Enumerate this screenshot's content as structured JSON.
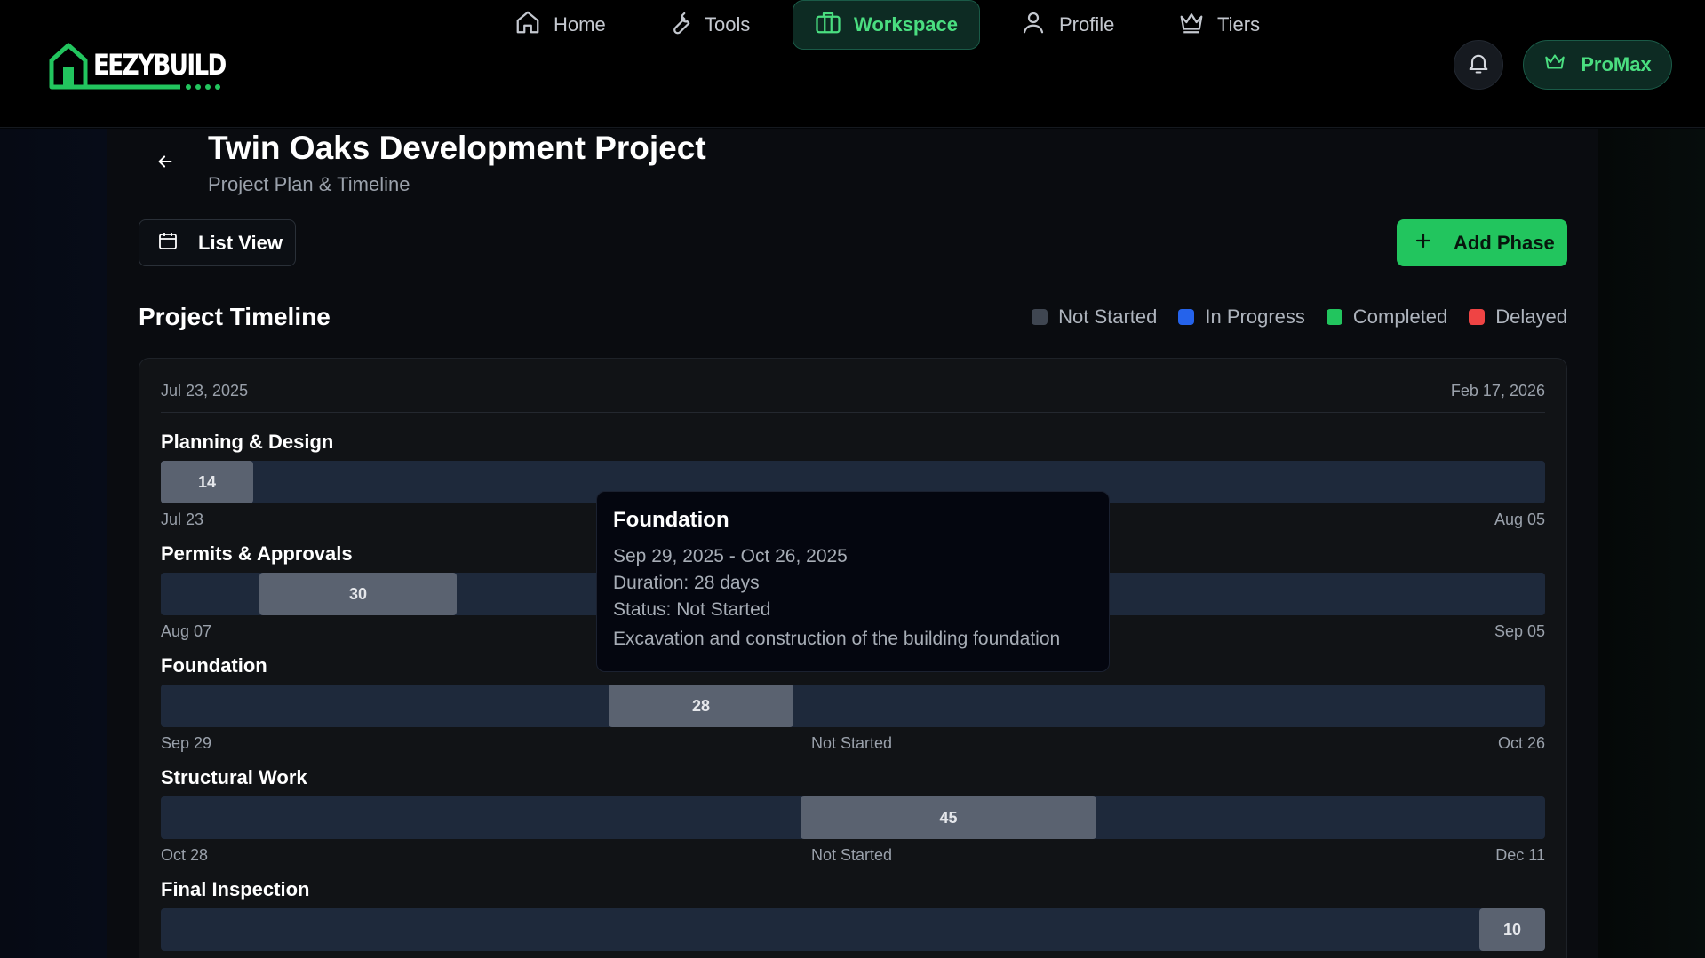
{
  "header": {
    "logo_text": "EEZYBUILD",
    "nav": [
      {
        "label": "Home",
        "icon": "home-icon"
      },
      {
        "label": "Tools",
        "icon": "wrench-icon"
      },
      {
        "label": "Workspace",
        "icon": "briefcase-icon"
      },
      {
        "label": "Profile",
        "icon": "user-icon"
      },
      {
        "label": "Tiers",
        "icon": "crown-icon"
      }
    ],
    "active_nav": "Workspace",
    "plan_label": "ProMax"
  },
  "page": {
    "title": "Twin Oaks Development Project",
    "subtitle": "Project Plan & Timeline",
    "list_view_label": "List View",
    "add_phase_label": "Add Phase"
  },
  "timeline": {
    "section_title": "Project Timeline",
    "legend": [
      {
        "label": "Not Started",
        "color": "#3f4651"
      },
      {
        "label": "In Progress",
        "color": "#2563eb"
      },
      {
        "label": "Completed",
        "color": "#22c55e"
      },
      {
        "label": "Delayed",
        "color": "#ef4444"
      }
    ],
    "range_start": "Jul 23, 2025",
    "range_end": "Feb 17, 2026",
    "phases": [
      {
        "name": "Planning & Design",
        "duration": "14",
        "start_label": "Jul 23",
        "end_label": "Aug 05",
        "status_label": ""
      },
      {
        "name": "Permits & Approvals",
        "duration": "30",
        "start_label": "Aug 07",
        "end_label": "Sep 05",
        "status_label": ""
      },
      {
        "name": "Foundation",
        "duration": "28",
        "start_label": "Sep 29",
        "end_label": "Oct 26",
        "status_label": "Not Started"
      },
      {
        "name": "Structural Work",
        "duration": "45",
        "start_label": "Oct 28",
        "end_label": "Dec 11",
        "status_label": "Not Started"
      },
      {
        "name": "Final Inspection",
        "duration": "10",
        "start_label": "",
        "end_label": "",
        "status_label": ""
      }
    ]
  },
  "tooltip": {
    "title": "Foundation",
    "dates": "Sep 29, 2025 - Oct 26, 2025",
    "duration": "Duration: 28 days",
    "status": "Status: Not Started",
    "description": "Excavation and construction of the building foundation"
  },
  "colors": {
    "accent": "#22c55e",
    "accent_text": "#4ade80",
    "bar_not_started": "#5a6270",
    "track": "#1e293b"
  }
}
